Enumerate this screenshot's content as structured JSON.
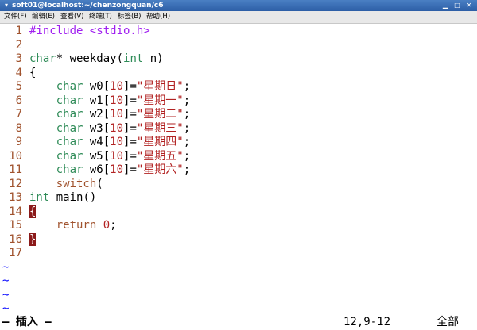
{
  "window": {
    "title": "soft01@localhost:~/chenzongquan/c6",
    "icon": "terminal-icon"
  },
  "menu": [
    {
      "label": "文件(F)"
    },
    {
      "label": "编辑(E)"
    },
    {
      "label": "查看(V)"
    },
    {
      "label": "终端(T)"
    },
    {
      "label": "标签(B)"
    },
    {
      "label": "帮助(H)"
    }
  ],
  "editor": {
    "lines": [
      {
        "num": "1",
        "segments": [
          {
            "t": "#include <stdio.h>",
            "c": "kw-purple"
          }
        ]
      },
      {
        "num": "2",
        "segments": []
      },
      {
        "num": "3",
        "segments": [
          {
            "t": "char",
            "c": "kw-green"
          },
          {
            "t": "* weekday(",
            "c": "code"
          },
          {
            "t": "int",
            "c": "kw-green"
          },
          {
            "t": " n)",
            "c": "code"
          }
        ]
      },
      {
        "num": "4",
        "segments": [
          {
            "t": "{",
            "c": "code"
          }
        ]
      },
      {
        "num": "5",
        "segments": [
          {
            "t": "    ",
            "c": "code"
          },
          {
            "t": "char",
            "c": "kw-green"
          },
          {
            "t": " w0[",
            "c": "code"
          },
          {
            "t": "10",
            "c": "str"
          },
          {
            "t": "]=",
            "c": "code"
          },
          {
            "t": "\"星期日\"",
            "c": "str"
          },
          {
            "t": ";",
            "c": "code"
          }
        ]
      },
      {
        "num": "6",
        "segments": [
          {
            "t": "    ",
            "c": "code"
          },
          {
            "t": "char",
            "c": "kw-green"
          },
          {
            "t": " w1[",
            "c": "code"
          },
          {
            "t": "10",
            "c": "str"
          },
          {
            "t": "]=",
            "c": "code"
          },
          {
            "t": "\"星期一\"",
            "c": "str"
          },
          {
            "t": ";",
            "c": "code"
          }
        ]
      },
      {
        "num": "7",
        "segments": [
          {
            "t": "    ",
            "c": "code"
          },
          {
            "t": "char",
            "c": "kw-green"
          },
          {
            "t": " w2[",
            "c": "code"
          },
          {
            "t": "10",
            "c": "str"
          },
          {
            "t": "]=",
            "c": "code"
          },
          {
            "t": "\"星期二\"",
            "c": "str"
          },
          {
            "t": ";",
            "c": "code"
          }
        ]
      },
      {
        "num": "8",
        "segments": [
          {
            "t": "    ",
            "c": "code"
          },
          {
            "t": "char",
            "c": "kw-green"
          },
          {
            "t": " w3[",
            "c": "code"
          },
          {
            "t": "10",
            "c": "str"
          },
          {
            "t": "]=",
            "c": "code"
          },
          {
            "t": "\"星期三\"",
            "c": "str"
          },
          {
            "t": ";",
            "c": "code"
          }
        ]
      },
      {
        "num": "9",
        "segments": [
          {
            "t": "    ",
            "c": "code"
          },
          {
            "t": "char",
            "c": "kw-green"
          },
          {
            "t": " w4[",
            "c": "code"
          },
          {
            "t": "10",
            "c": "str"
          },
          {
            "t": "]=",
            "c": "code"
          },
          {
            "t": "\"星期四\"",
            "c": "str"
          },
          {
            "t": ";",
            "c": "code"
          }
        ]
      },
      {
        "num": "10",
        "segments": [
          {
            "t": "    ",
            "c": "code"
          },
          {
            "t": "char",
            "c": "kw-green"
          },
          {
            "t": " w5[",
            "c": "code"
          },
          {
            "t": "10",
            "c": "str"
          },
          {
            "t": "]=",
            "c": "code"
          },
          {
            "t": "\"星期五\"",
            "c": "str"
          },
          {
            "t": ";",
            "c": "code"
          }
        ]
      },
      {
        "num": "11",
        "segments": [
          {
            "t": "    ",
            "c": "code"
          },
          {
            "t": "char",
            "c": "kw-green"
          },
          {
            "t": " w6[",
            "c": "code"
          },
          {
            "t": "10",
            "c": "str"
          },
          {
            "t": "]=",
            "c": "code"
          },
          {
            "t": "\"星期六\"",
            "c": "str"
          },
          {
            "t": ";",
            "c": "code"
          }
        ]
      },
      {
        "num": "12",
        "segments": [
          {
            "t": "    ",
            "c": "code"
          },
          {
            "t": "switch",
            "c": "kw-orange"
          },
          {
            "t": "(",
            "c": "code"
          }
        ]
      },
      {
        "num": "13",
        "segments": [
          {
            "t": "int",
            "c": "kw-green"
          },
          {
            "t": " main()",
            "c": "code"
          }
        ]
      },
      {
        "num": "14",
        "segments": [
          {
            "t": "{",
            "c": "brace-hl"
          }
        ]
      },
      {
        "num": "15",
        "segments": [
          {
            "t": "    ",
            "c": "code"
          },
          {
            "t": "return",
            "c": "kw-orange"
          },
          {
            "t": " ",
            "c": "code"
          },
          {
            "t": "0",
            "c": "str"
          },
          {
            "t": ";",
            "c": "code"
          }
        ]
      },
      {
        "num": "16",
        "segments": [
          {
            "t": "}",
            "c": "brace-hl"
          }
        ]
      },
      {
        "num": "17",
        "segments": []
      }
    ],
    "tildes": [
      "~",
      "~",
      "~",
      "~"
    ]
  },
  "status": {
    "mode": "— 插入 —",
    "cursor": "12,9-12",
    "scroll": "全部"
  },
  "colors": {
    "titlebar": "#2c5ea6",
    "line_number": "#a0522d",
    "type_keyword": "#2e8b57",
    "statement_keyword": "#a0522d",
    "preprocessor": "#a020f0",
    "constant": "#b22222",
    "matching_brace": "#8b1a1a",
    "tilde": "#0000ff"
  }
}
